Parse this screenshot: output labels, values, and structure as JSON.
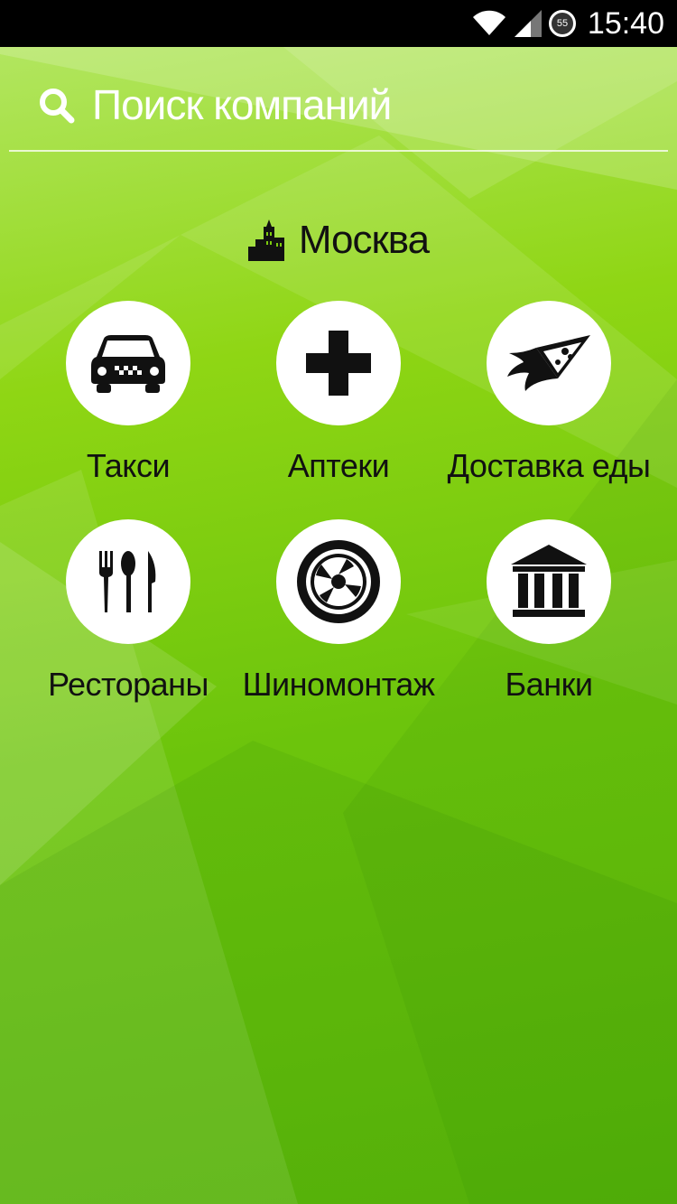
{
  "status_bar": {
    "time": "15:40",
    "battery_level": "55"
  },
  "search": {
    "placeholder": "Поиск компаний",
    "value": ""
  },
  "city": {
    "name": "Москва"
  },
  "categories": [
    {
      "label": "Такси",
      "icon": "taxi-icon"
    },
    {
      "label": "Аптеки",
      "icon": "pharmacy-cross-icon"
    },
    {
      "label": "Доставка еды",
      "icon": "pizza-delivery-icon"
    },
    {
      "label": "Рестораны",
      "icon": "cutlery-icon"
    },
    {
      "label": "Шиномонтаж",
      "icon": "tire-icon"
    },
    {
      "label": "Банки",
      "icon": "bank-icon"
    }
  ],
  "colors": {
    "background": "#7ccb0e",
    "circle": "#ffffff",
    "text": "#111111"
  }
}
